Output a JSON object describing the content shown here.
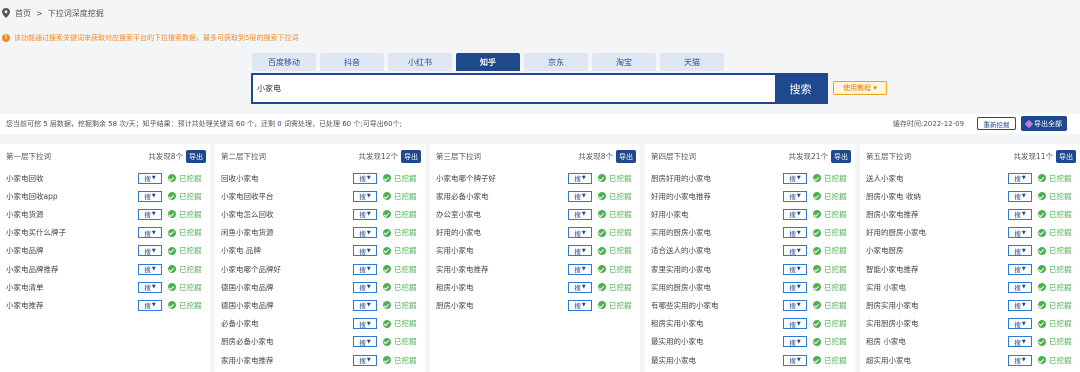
{
  "breadcrumb": {
    "home": "首页",
    "sep": ">",
    "current": "下拉词深度挖掘"
  },
  "notice": "该功能通过搜索关键词来获取对应搜索平台的下拉搜索数据，最多可获取到5层的搜索下拉词",
  "tabs": [
    "百度移动",
    "抖音",
    "小红书",
    "知乎",
    "京东",
    "淘宝",
    "天猫"
  ],
  "active_tab": "知乎",
  "search": {
    "value": "小家电",
    "button": "搜索"
  },
  "tutorial_label": "使用教程 ▾",
  "info": {
    "p1": "您当前可挖 ",
    "layers": "5",
    "p2": " 层数据，挖掘剩余 ",
    "remaining": "58",
    "p3": " 次/天；知乎结果：预计共处理关键词 ",
    "total": "60",
    "p4": " 个，还剩 ",
    "left": "0",
    "p5": " 词需处理，已处理 ",
    "done": "60",
    "p6": " 个;可导出60个;"
  },
  "cache_time": "缓存时间:2022-12-09",
  "rescan_label": "重新挖掘",
  "export_all_label": "导出全部",
  "search_select_label": "搜",
  "status_label": "已挖掘",
  "export_label": "导出",
  "columns": [
    {
      "title": "第一层下拉词",
      "count": "共发现8个",
      "items": [
        "小家电回收",
        "小家电回收app",
        "小家电货源",
        "小家电买什么牌子",
        "小家电品牌",
        "小家电品牌推荐",
        "小家电清单",
        "小家电推荐"
      ]
    },
    {
      "title": "第二层下拉词",
      "count": "共发现12个",
      "items": [
        "回收小家电",
        "小家电回收平台",
        "小家电怎么回收",
        "闲鱼小家电货源",
        "小家电 品牌",
        "小家电哪个品牌好",
        "德国小家电品牌",
        "德国小家电品牌",
        "必备小家电",
        "厨房必备小家电",
        "家用小家电推荐"
      ]
    },
    {
      "title": "第三层下拉词",
      "count": "共发现8个",
      "items": [
        "小家电哪个牌子好",
        "家用必备小家电",
        "办公室小家电",
        "好用的小家电",
        "实用小家电",
        "实用小家电推荐",
        "租房小家电",
        "厨房小家电"
      ]
    },
    {
      "title": "第四层下拉词",
      "count": "共发现21个",
      "items": [
        "厨房好用的小家电",
        "好用的小家电推荐",
        "好用小家电",
        "实用的厨房小家电",
        "适合送人的小家电",
        "家里实用的小家电",
        "实用的厨房小家电",
        "有哪些实用的小家电",
        "租房实用小家电",
        "最实用的小家电",
        "最实用小家电"
      ]
    },
    {
      "title": "第五层下拉词",
      "count": "共发现11个",
      "items": [
        "送人小家电",
        "厨房小家电 收纳",
        "厨房小家电推荐",
        "好用的厨房小家电",
        "小家电厨房",
        "智能小家电推荐",
        "实用 小家电",
        "厨房实用小家电",
        "实用厨房小家电",
        "租房 小家电",
        "超实用小家电"
      ]
    }
  ]
}
